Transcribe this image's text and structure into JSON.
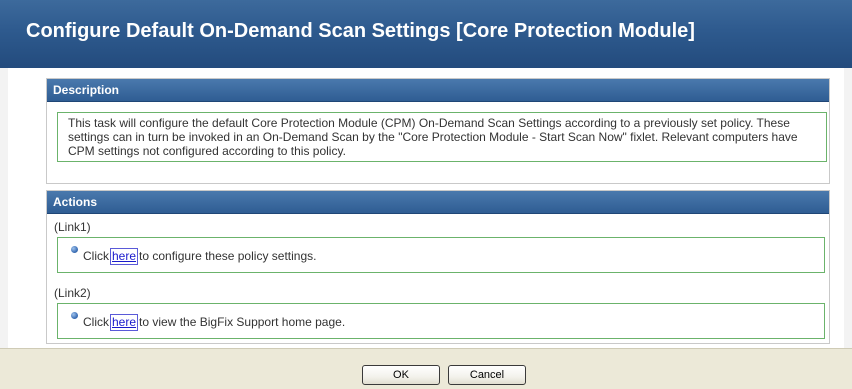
{
  "window": {
    "title": "Configure Default On-Demand Scan Settings [Core Protection Module]"
  },
  "description": {
    "header": "Description",
    "text": "This task will configure the default Core Protection Module (CPM) On-Demand Scan Settings according to a previously set policy. These settings can in turn be invoked in an On-Demand Scan by the \"Core Protection Module - Start Scan Now\" fixlet. Relevant computers have CPM settings not configured according to this policy."
  },
  "actions": {
    "header": "Actions",
    "links": [
      {
        "caption": "(Link1)",
        "prefix": "Click",
        "link_text": "here",
        "suffix": "to configure these policy settings."
      },
      {
        "caption": "(Link2)",
        "prefix": "Click",
        "link_text": "here",
        "suffix": "to view the BigFix Support home page."
      }
    ]
  },
  "footer": {
    "ok_label": "OK",
    "cancel_label": "Cancel"
  }
}
